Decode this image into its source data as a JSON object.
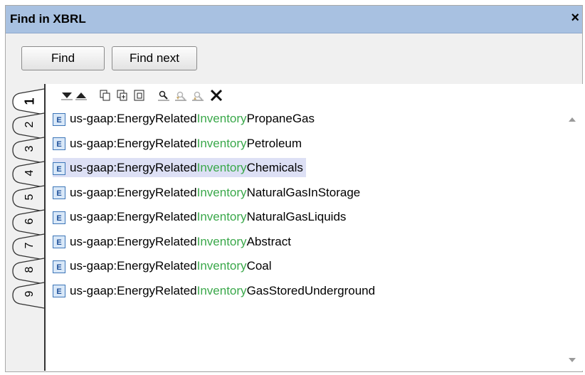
{
  "window": {
    "title": "Find in XBRL",
    "close_label": "×"
  },
  "buttons": {
    "find": "Find",
    "find_next": "Find next"
  },
  "tabs": [
    "1",
    "2",
    "3",
    "4",
    "5",
    "6",
    "7",
    "8",
    "9"
  ],
  "active_tab": "1",
  "toolbar_icons": [
    "arrow-down-icon",
    "arrow-up-icon",
    "copy-icon",
    "copy-add-icon",
    "paste-icon",
    "search-icon",
    "find-prev-icon",
    "find-next-icon",
    "delete-icon"
  ],
  "results": [
    {
      "prefix": "us-gaap:EnergyRelated",
      "match": "Inventory",
      "suffix": "PropaneGas",
      "icon": "E"
    },
    {
      "prefix": "us-gaap:EnergyRelated",
      "match": "Inventory",
      "suffix": "Petroleum",
      "icon": "E"
    },
    {
      "prefix": "us-gaap:EnergyRelated",
      "match": "Inventory",
      "suffix": "Chemicals",
      "icon": "E",
      "selected": true
    },
    {
      "prefix": "us-gaap:EnergyRelated",
      "match": "Inventory",
      "suffix": "NaturalGasInStorage",
      "icon": "E"
    },
    {
      "prefix": "us-gaap:EnergyRelated",
      "match": "Inventory",
      "suffix": "NaturalGasLiquids",
      "icon": "E"
    },
    {
      "prefix": "us-gaap:EnergyRelated",
      "match": "Inventory",
      "suffix": "Abstract",
      "icon": "E"
    },
    {
      "prefix": "us-gaap:EnergyRelated",
      "match": "Inventory",
      "suffix": "Coal",
      "icon": "E"
    },
    {
      "prefix": "us-gaap:EnergyRelated",
      "match": "Inventory",
      "suffix": "GasStoredUnderground",
      "icon": "E"
    }
  ],
  "colors": {
    "titlebar": "#a8c1e1",
    "match_highlight": "#3aa84a",
    "selection": "#dde0f5"
  }
}
